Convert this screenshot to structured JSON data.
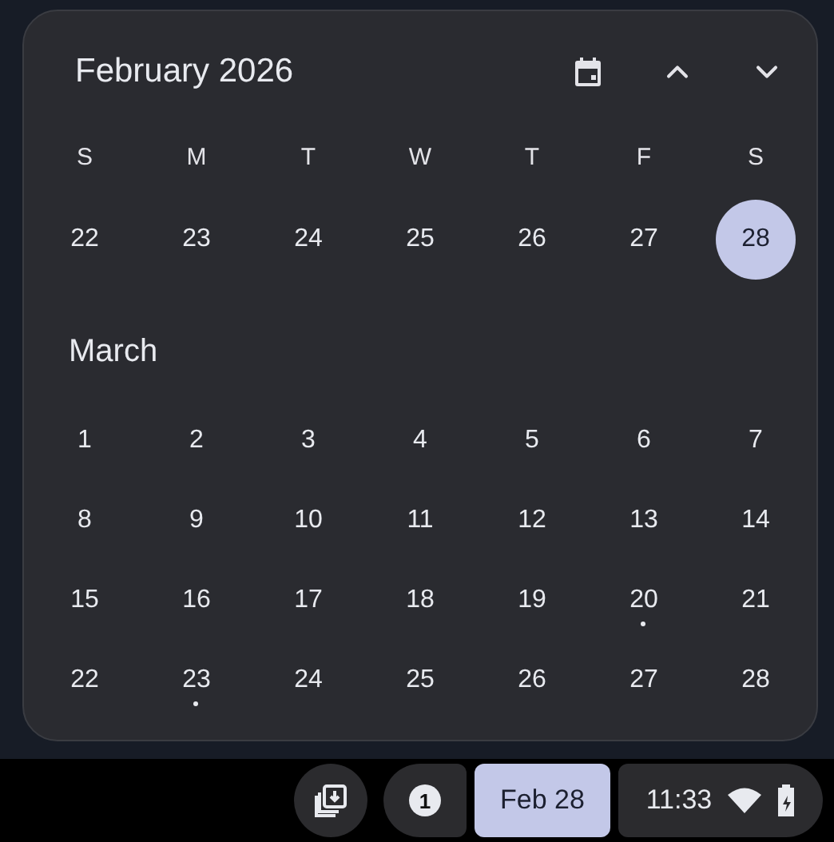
{
  "calendar": {
    "title": "February 2026",
    "weekdays": [
      "S",
      "M",
      "T",
      "W",
      "T",
      "F",
      "S"
    ],
    "sections": [
      {
        "weeks": [
          [
            {
              "day": "22",
              "selected": false,
              "event": false
            },
            {
              "day": "23",
              "selected": false,
              "event": false
            },
            {
              "day": "24",
              "selected": false,
              "event": false
            },
            {
              "day": "25",
              "selected": false,
              "event": false
            },
            {
              "day": "26",
              "selected": false,
              "event": false
            },
            {
              "day": "27",
              "selected": false,
              "event": false
            },
            {
              "day": "28",
              "selected": true,
              "event": false
            }
          ]
        ]
      },
      {
        "label": "March",
        "weeks": [
          [
            {
              "day": "1",
              "selected": false,
              "event": false
            },
            {
              "day": "2",
              "selected": false,
              "event": false
            },
            {
              "day": "3",
              "selected": false,
              "event": false
            },
            {
              "day": "4",
              "selected": false,
              "event": false
            },
            {
              "day": "5",
              "selected": false,
              "event": false
            },
            {
              "day": "6",
              "selected": false,
              "event": false
            },
            {
              "day": "7",
              "selected": false,
              "event": false
            }
          ],
          [
            {
              "day": "8",
              "selected": false,
              "event": false
            },
            {
              "day": "9",
              "selected": false,
              "event": false
            },
            {
              "day": "10",
              "selected": false,
              "event": false
            },
            {
              "day": "11",
              "selected": false,
              "event": false
            },
            {
              "day": "12",
              "selected": false,
              "event": false
            },
            {
              "day": "13",
              "selected": false,
              "event": false
            },
            {
              "day": "14",
              "selected": false,
              "event": false
            }
          ],
          [
            {
              "day": "15",
              "selected": false,
              "event": false
            },
            {
              "day": "16",
              "selected": false,
              "event": false
            },
            {
              "day": "17",
              "selected": false,
              "event": false
            },
            {
              "day": "18",
              "selected": false,
              "event": false
            },
            {
              "day": "19",
              "selected": false,
              "event": false
            },
            {
              "day": "20",
              "selected": false,
              "event": true
            },
            {
              "day": "21",
              "selected": false,
              "event": false
            }
          ],
          [
            {
              "day": "22",
              "selected": false,
              "event": false
            },
            {
              "day": "23",
              "selected": false,
              "event": true
            },
            {
              "day": "24",
              "selected": false,
              "event": false
            },
            {
              "day": "25",
              "selected": false,
              "event": false
            },
            {
              "day": "26",
              "selected": false,
              "event": false
            },
            {
              "day": "27",
              "selected": false,
              "event": false
            },
            {
              "day": "28",
              "selected": false,
              "event": false
            }
          ]
        ]
      }
    ]
  },
  "taskbar": {
    "notification_count": "1",
    "date": "Feb 28",
    "date_active": true,
    "time": "11:33"
  }
}
